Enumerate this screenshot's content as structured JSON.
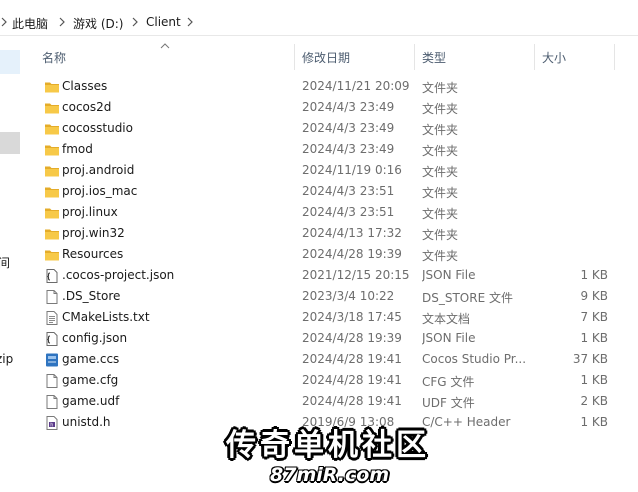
{
  "breadcrumb": [
    "此电脑",
    "游戏 (D:)",
    "Client"
  ],
  "nav_cut": [
    "间",
    "zip"
  ],
  "columns": {
    "name": "名称",
    "date": "修改日期",
    "type": "类型",
    "size": "大小"
  },
  "files": [
    {
      "name": "Classes",
      "date": "2024/11/21 20:09",
      "type": "文件夹",
      "size": "",
      "icon": "folder-icon"
    },
    {
      "name": "cocos2d",
      "date": "2024/4/3 23:49",
      "type": "文件夹",
      "size": "",
      "icon": "folder-icon"
    },
    {
      "name": "cocosstudio",
      "date": "2024/4/3 23:49",
      "type": "文件夹",
      "size": "",
      "icon": "folder-icon"
    },
    {
      "name": "fmod",
      "date": "2024/4/3 23:49",
      "type": "文件夹",
      "size": "",
      "icon": "folder-icon"
    },
    {
      "name": "proj.android",
      "date": "2024/11/19 0:16",
      "type": "文件夹",
      "size": "",
      "icon": "folder-icon"
    },
    {
      "name": "proj.ios_mac",
      "date": "2024/4/3 23:51",
      "type": "文件夹",
      "size": "",
      "icon": "folder-icon"
    },
    {
      "name": "proj.linux",
      "date": "2024/4/3 23:51",
      "type": "文件夹",
      "size": "",
      "icon": "folder-icon"
    },
    {
      "name": "proj.win32",
      "date": "2024/4/13 17:32",
      "type": "文件夹",
      "size": "",
      "icon": "folder-icon"
    },
    {
      "name": "Resources",
      "date": "2024/4/28 19:39",
      "type": "文件夹",
      "size": "",
      "icon": "folder-icon"
    },
    {
      "name": ".cocos-project.json",
      "date": "2021/12/15 20:15",
      "type": "JSON File",
      "size": "1 KB",
      "icon": "json-file-icon"
    },
    {
      "name": ".DS_Store",
      "date": "2023/3/4 10:22",
      "type": "DS_STORE 文件",
      "size": "9 KB",
      "icon": "blank-file-icon"
    },
    {
      "name": "CMakeLists.txt",
      "date": "2024/3/18 17:45",
      "type": "文本文档",
      "size": "7 KB",
      "icon": "text-file-icon"
    },
    {
      "name": "config.json",
      "date": "2024/4/28 19:39",
      "type": "JSON File",
      "size": "1 KB",
      "icon": "json-file-icon"
    },
    {
      "name": "game.ccs",
      "date": "2024/4/28 19:41",
      "type": "Cocos Studio Pr...",
      "size": "37 KB",
      "icon": "cocos-studio-file-icon"
    },
    {
      "name": "game.cfg",
      "date": "2024/4/28 19:41",
      "type": "CFG 文件",
      "size": "1 KB",
      "icon": "blank-file-icon"
    },
    {
      "name": "game.udf",
      "date": "2024/4/28 19:41",
      "type": "UDF 文件",
      "size": "2 KB",
      "icon": "blank-file-icon"
    },
    {
      "name": "unistd.h",
      "date": "2019/6/9 13:08",
      "type": "C/C++ Header",
      "size": "1 KB",
      "icon": "header-file-icon"
    }
  ],
  "watermark": {
    "line1": "传奇单机社区",
    "line2": "87miR.com"
  },
  "colors": {
    "folder": "#f7c948",
    "folder_dark": "#e4ac2a",
    "header_text": "#4d5d70",
    "selection": "#e5f1fb"
  }
}
